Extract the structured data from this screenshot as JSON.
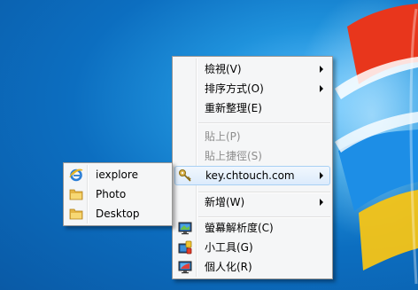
{
  "context_menu": {
    "items": [
      {
        "label": "檢視(V)",
        "has_submenu": true,
        "enabled": true
      },
      {
        "label": "排序方式(O)",
        "has_submenu": true,
        "enabled": true
      },
      {
        "label": "重新整理(E)",
        "has_submenu": false,
        "enabled": true
      },
      {
        "label": "貼上(P)",
        "has_submenu": false,
        "enabled": false
      },
      {
        "label": "貼上捷徑(S)",
        "has_submenu": false,
        "enabled": false
      },
      {
        "label": "key.chtouch.com",
        "has_submenu": true,
        "enabled": true,
        "highlighted": true,
        "icon": "key-icon"
      },
      {
        "label": "新增(W)",
        "has_submenu": true,
        "enabled": true
      },
      {
        "label": "螢幕解析度(C)",
        "has_submenu": false,
        "enabled": true,
        "icon": "display-icon"
      },
      {
        "label": "小工具(G)",
        "has_submenu": false,
        "enabled": true,
        "icon": "gadgets-icon"
      },
      {
        "label": "個人化(R)",
        "has_submenu": false,
        "enabled": true,
        "icon": "personalize-icon"
      }
    ]
  },
  "submenu": {
    "items": [
      {
        "label": "iexplore",
        "icon": "internet-explorer-icon"
      },
      {
        "label": "Photo",
        "icon": "folder-icon"
      },
      {
        "label": "Desktop",
        "icon": "folder-icon"
      }
    ]
  },
  "colors": {
    "desktop_blue": "#0c6ec0",
    "menu_bg": "#f5f6f7",
    "highlight_border": "#a8d0f4",
    "disabled_text": "#8d8d8d"
  }
}
